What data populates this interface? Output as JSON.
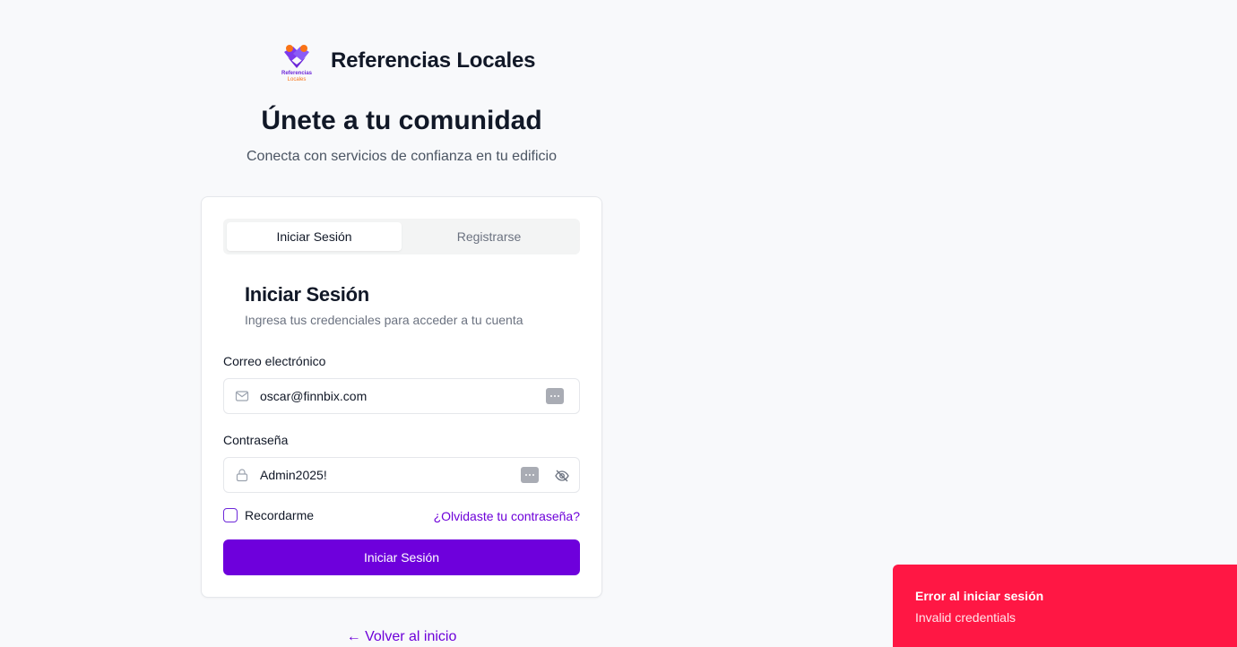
{
  "brand": {
    "name": "Referencias Locales",
    "logo_text_line1": "Referencias",
    "logo_text_line2": "Locales",
    "colors": {
      "logo_purple": "#7c3aed",
      "logo_orange": "#f97316"
    }
  },
  "hero": {
    "title": "Únete a tu comunidad",
    "subtitle": "Conecta con servicios de confianza en tu edificio"
  },
  "tabs": [
    {
      "label": "Iniciar Sesión",
      "active": true
    },
    {
      "label": "Registrarse",
      "active": false
    }
  ],
  "form": {
    "title": "Iniciar Sesión",
    "subtitle": "Ingresa tus credenciales para acceder a tu cuenta",
    "email": {
      "label": "Correo electrónico",
      "value": "oscar@finnbix.com",
      "icon": "mail-icon"
    },
    "password": {
      "label": "Contraseña",
      "value": "Admin2025!",
      "icon": "lock-icon",
      "toggle_icon": "eye-off-icon"
    },
    "remember_label": "Recordarme",
    "remember_checked": false,
    "forgot_label": "¿Olvidaste tu contraseña?",
    "submit_label": "Iniciar Sesión"
  },
  "back_link": "← Volver al inicio",
  "toast": {
    "title": "Error al iniciar sesión",
    "description": "Invalid credentials",
    "color": "#ff1744"
  },
  "colors": {
    "accent": "#6e00dc",
    "background": "#f8f9fb"
  }
}
